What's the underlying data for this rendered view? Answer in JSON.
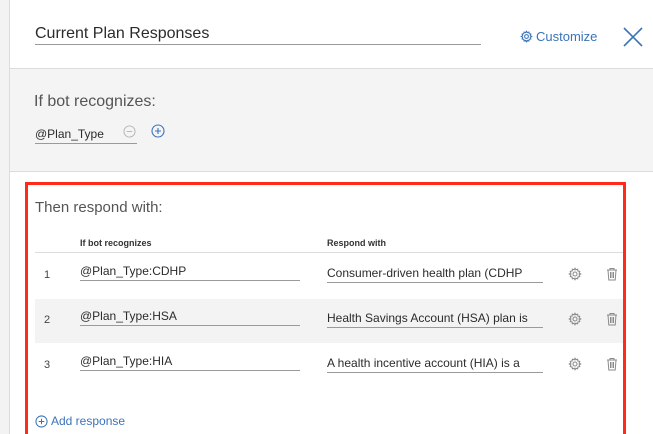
{
  "header": {
    "title": "Current Plan Responses",
    "customize_label": "Customize"
  },
  "condition": {
    "label": "If bot recognizes:",
    "value": "@Plan_Type"
  },
  "responses": {
    "label": "Then respond with:",
    "col_condition": "If bot recognizes",
    "col_response": "Respond with",
    "rows": [
      {
        "num": "1",
        "condition": "@Plan_Type:CDHP",
        "response": "Consumer-driven health plan (CDHP"
      },
      {
        "num": "2",
        "condition": "@Plan_Type:HSA",
        "response": "Health Savings Account (HSA) plan is"
      },
      {
        "num": "3",
        "condition": "@Plan_Type:HIA",
        "response": "A health incentive account (HIA) is a"
      }
    ],
    "add_label": "Add response"
  },
  "colors": {
    "accent": "#3b73b9",
    "highlight": "#ff2a1a"
  }
}
